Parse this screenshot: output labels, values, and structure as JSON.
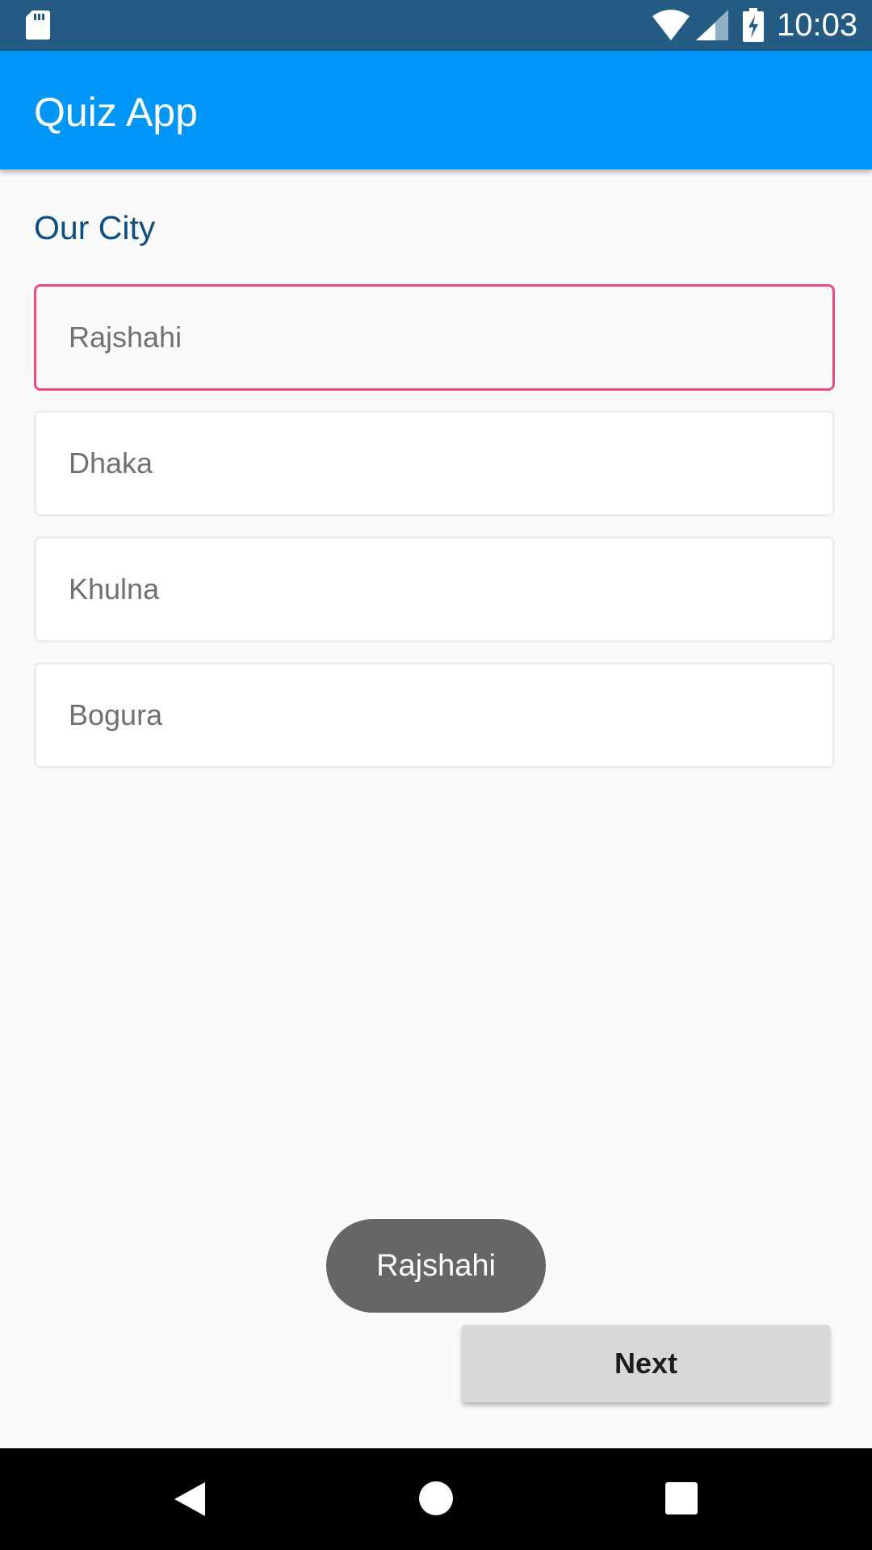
{
  "status_bar": {
    "time": "10:03",
    "icons": [
      "sd-card-icon",
      "wifi-icon",
      "signal-icon",
      "battery-charging-icon"
    ]
  },
  "app_bar": {
    "title": "Quiz App"
  },
  "quiz": {
    "question": "Our City",
    "options": [
      "Rajshahi",
      "Dhaka",
      "Khulna",
      "Bogura"
    ],
    "selected": "Rajshahi"
  },
  "toast": {
    "text": "Rajshahi"
  },
  "actions": {
    "next_label": "Next"
  },
  "nav_bar": {
    "icons": [
      "back-icon",
      "home-icon",
      "recents-icon"
    ]
  },
  "colors": {
    "status_bar": "#245b83",
    "app_bar": "#0096f7",
    "question_text": "#0c4f7e",
    "selected_border": "#ea4a85",
    "toast_bg": "#666666",
    "button_bg": "#d7d8d8"
  }
}
